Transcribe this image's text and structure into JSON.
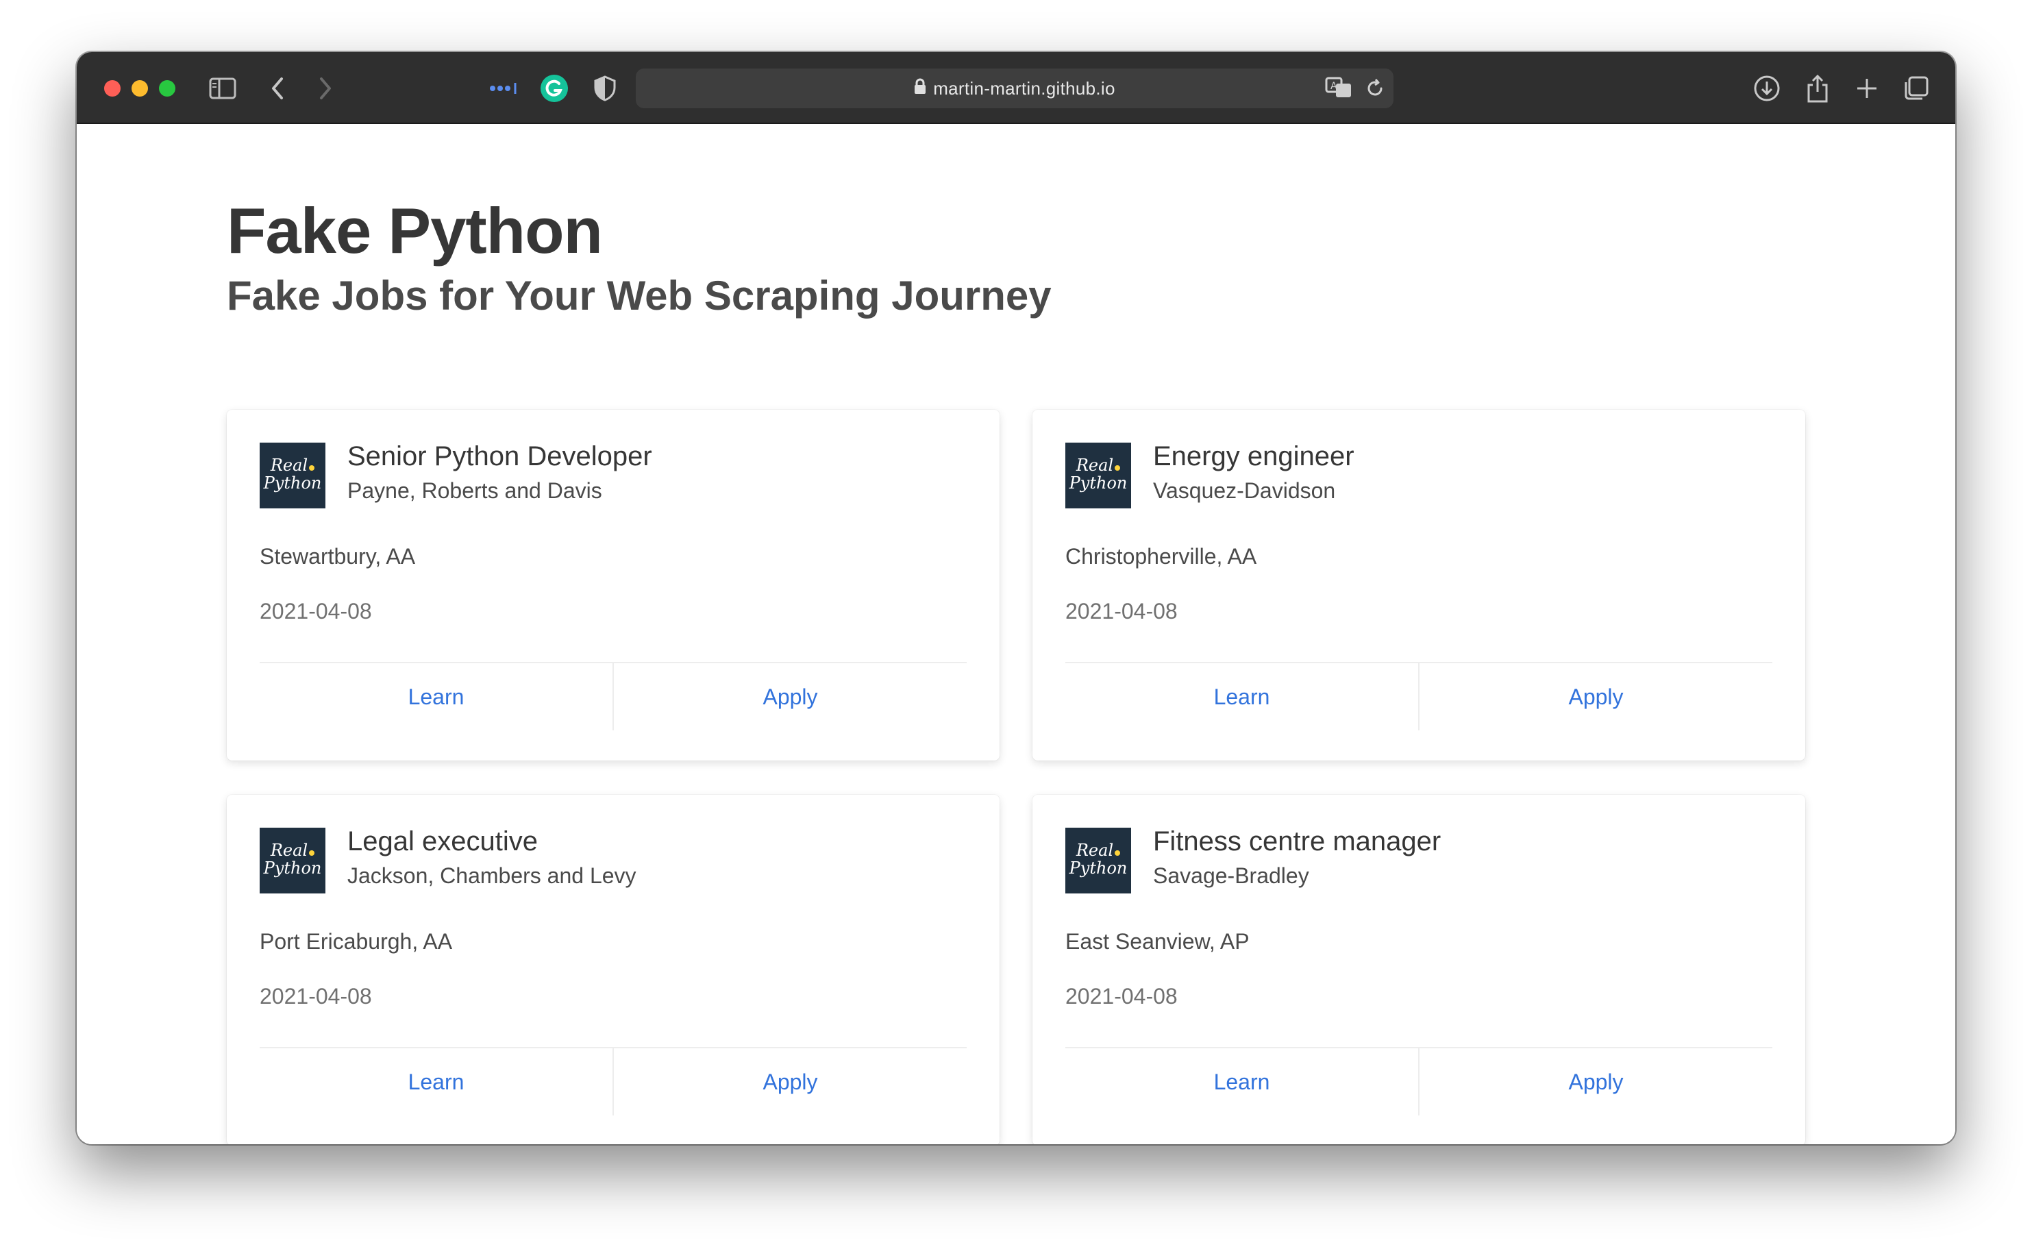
{
  "browser": {
    "url": "martin-martin.github.io",
    "icons": [
      "sidebar-icon",
      "back-icon",
      "forward-icon",
      "password-icon",
      "grammarly-icon",
      "privacy-shield-icon",
      "translate-icon",
      "reload-icon",
      "download-icon",
      "share-icon",
      "new-tab-icon",
      "tabs-overview-icon"
    ]
  },
  "page": {
    "title": "Fake Python",
    "subtitle": "Fake Jobs for Your Web Scraping Journey"
  },
  "jobs": [
    {
      "title": "Senior Python Developer",
      "company": "Payne, Roberts and Davis",
      "location": "Stewartbury, AA",
      "date": "2021-04-08",
      "learn_label": "Learn",
      "apply_label": "Apply"
    },
    {
      "title": "Energy engineer",
      "company": "Vasquez-Davidson",
      "location": "Christopherville, AA",
      "date": "2021-04-08",
      "learn_label": "Learn",
      "apply_label": "Apply"
    },
    {
      "title": "Legal executive",
      "company": "Jackson, Chambers and Levy",
      "location": "Port Ericaburgh, AA",
      "date": "2021-04-08",
      "learn_label": "Learn",
      "apply_label": "Apply"
    },
    {
      "title": "Fitness centre manager",
      "company": "Savage-Bradley",
      "location": "East Seanview, AP",
      "date": "2021-04-08",
      "learn_label": "Learn",
      "apply_label": "Apply"
    }
  ],
  "logo_text": [
    "Real",
    "Python"
  ],
  "colors": {
    "link": "#3273dc",
    "titlebar": "#2f2f2f",
    "logo_bg": "#1f3040"
  }
}
